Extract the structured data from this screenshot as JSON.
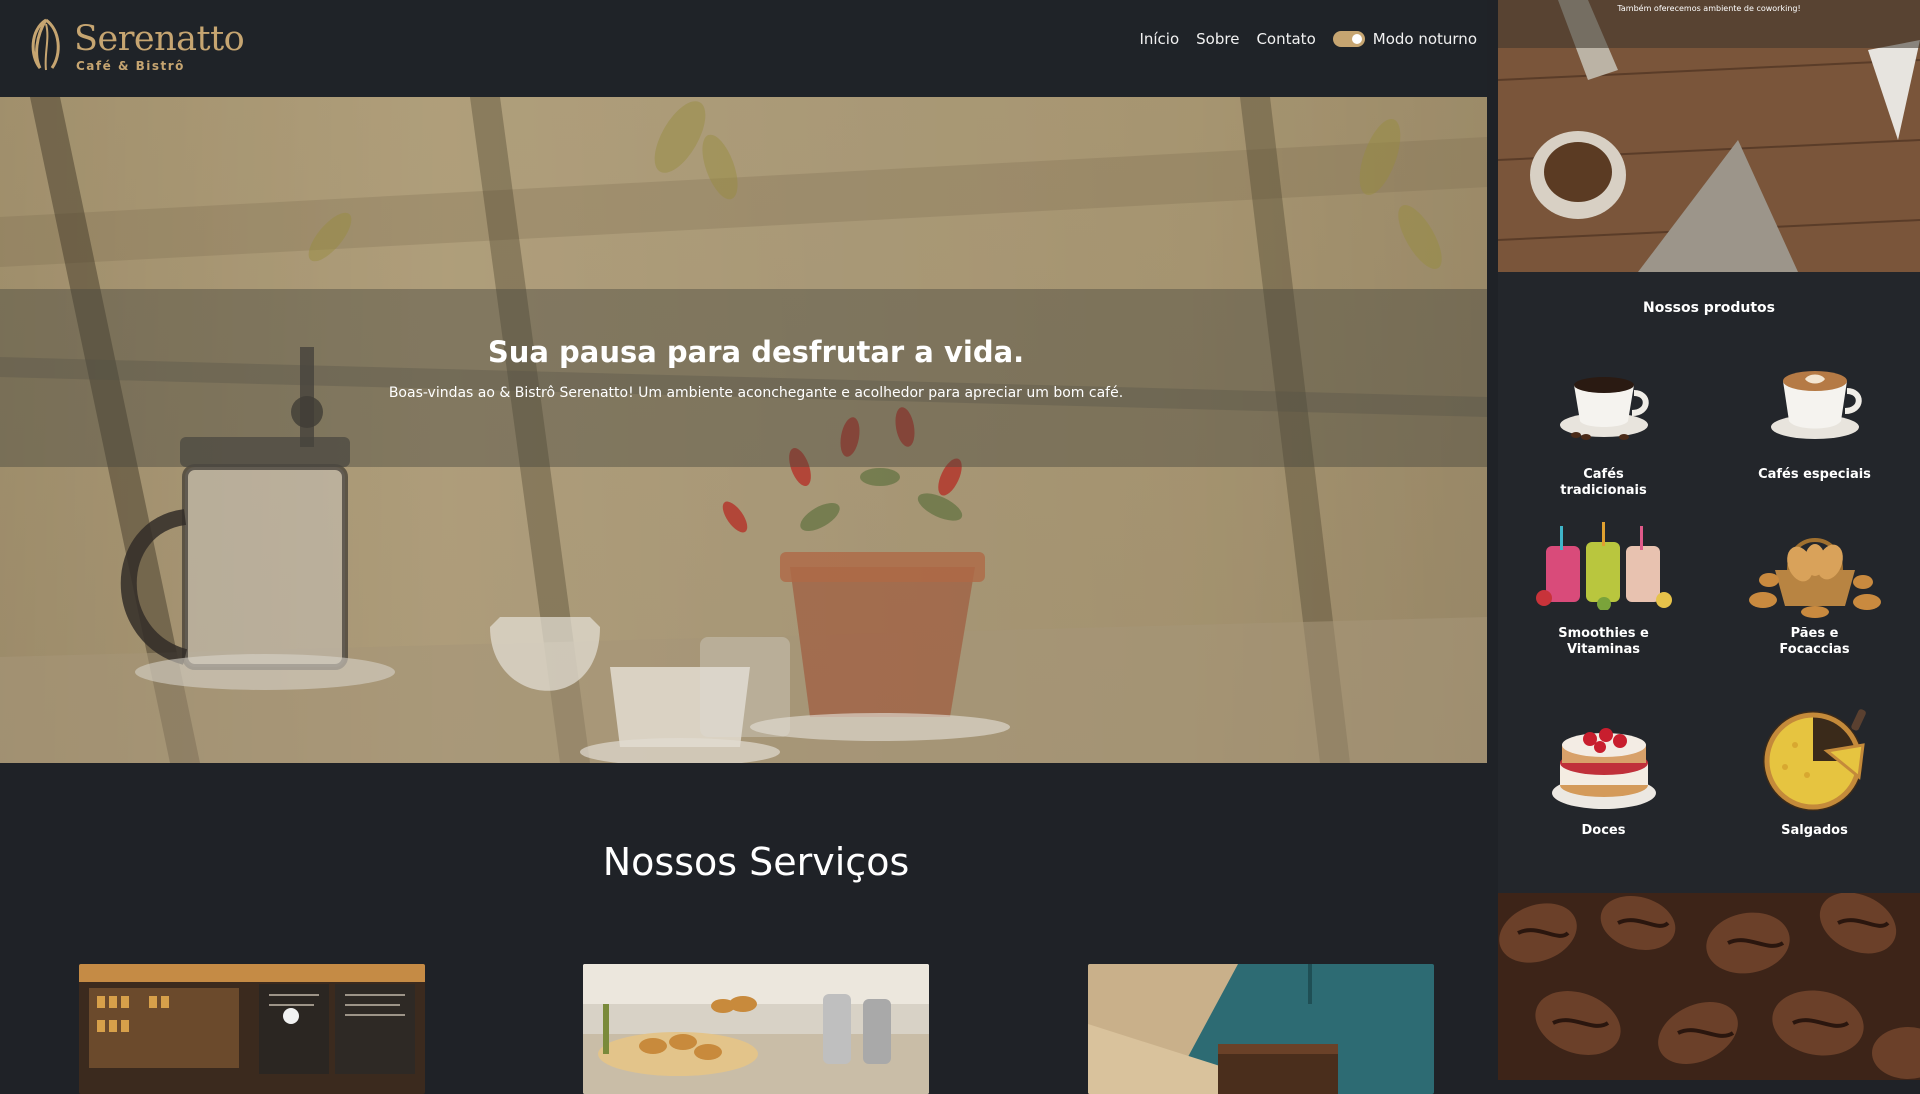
{
  "brand": {
    "name": "Serenatto",
    "tagline": "Café & Bistrô",
    "color": "#c6a571"
  },
  "nav": {
    "links": [
      "Início",
      "Sobre",
      "Contato"
    ],
    "toggle_label": "Modo noturno",
    "toggle_on": true
  },
  "hero": {
    "title": "Sua pausa para desfrutar a vida.",
    "text": "Boas-vindas ao & Bistrô Serenatto! Um ambiente aconchegante e acolhedor para apreciar um bom café."
  },
  "services": {
    "title": "Nossos Serviços"
  },
  "aside": {
    "banner_caption": "Também oferecemos ambiente de coworking!",
    "products_title": "Nossos produtos",
    "products": [
      {
        "label": "Cafés tradicionais",
        "icon": "coffee-cup-icon"
      },
      {
        "label": "Cafés especiais",
        "icon": "latte-art-icon"
      },
      {
        "label": "Smoothies e Vitaminas",
        "icon": "smoothie-icon"
      },
      {
        "label": "Pães e Focaccias",
        "icon": "bread-basket-icon"
      },
      {
        "label": "Doces",
        "icon": "cake-icon"
      },
      {
        "label": "Salgados",
        "icon": "quiche-icon"
      }
    ]
  }
}
